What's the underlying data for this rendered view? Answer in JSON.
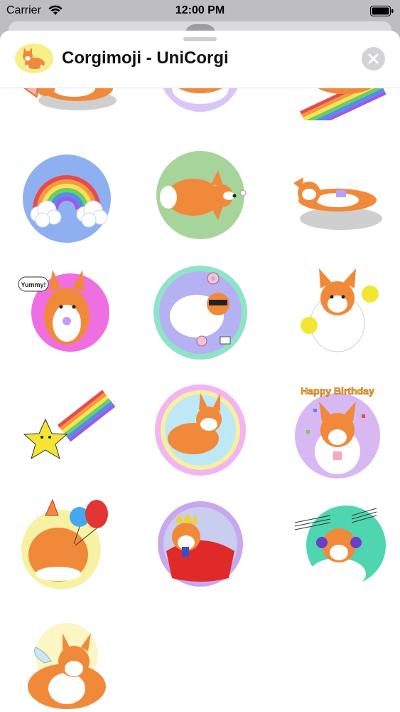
{
  "status_bar": {
    "carrier": "Carrier",
    "time": "12:00 PM"
  },
  "sheet": {
    "title": "Corgimoji - UniCorgi",
    "app_icon": "corgi-app-icon",
    "close_icon": "close-icon"
  },
  "stickers": [
    {
      "id": "s1",
      "name": "corgi-lying-sticker",
      "bg": "#cfcfcf"
    },
    {
      "id": "s2",
      "name": "corgi-butt-sticker",
      "bg": "#d9c6f6"
    },
    {
      "id": "s3",
      "name": "corgi-rainbow-slide-sticker",
      "bg": "#ffffff"
    },
    {
      "id": "s4",
      "name": "rainbow-clouds-sticker",
      "bg": "#8fb0f0"
    },
    {
      "id": "s5",
      "name": "corgi-topdown-sticker",
      "bg": "#a7d49a"
    },
    {
      "id": "s6",
      "name": "corgi-lying-belly-sticker",
      "bg": "#cfcfcf"
    },
    {
      "id": "s7",
      "name": "corgi-yummy-sticker",
      "bg": "#ef6fe2",
      "caption": "Yummy!"
    },
    {
      "id": "s8",
      "name": "corgi-sunglasses-donut-sticker",
      "bg": "#8fe3c8"
    },
    {
      "id": "s9",
      "name": "corgi-cheerleader-sticker",
      "bg": "#ffffff"
    },
    {
      "id": "s10",
      "name": "shooting-star-rainbow-sticker",
      "bg": "#ffffff"
    },
    {
      "id": "s11",
      "name": "corgi-pastel-circle-sticker",
      "bg": "#f3b4f2"
    },
    {
      "id": "s12",
      "name": "corgi-happy-birthday-sticker",
      "bg": "#d7b8f3",
      "caption": "Happy Birthday"
    },
    {
      "id": "s13",
      "name": "corgi-party-balloons-sticker",
      "bg": "#f7f2a3"
    },
    {
      "id": "s14",
      "name": "corgi-king-cape-sticker",
      "bg": "#c9a7ef"
    },
    {
      "id": "s15",
      "name": "corgi-music-headphones-sticker",
      "bg": "#4fd6b1"
    },
    {
      "id": "s16",
      "name": "corgi-angel-wings-sticker",
      "bg": "#ffffff"
    }
  ]
}
